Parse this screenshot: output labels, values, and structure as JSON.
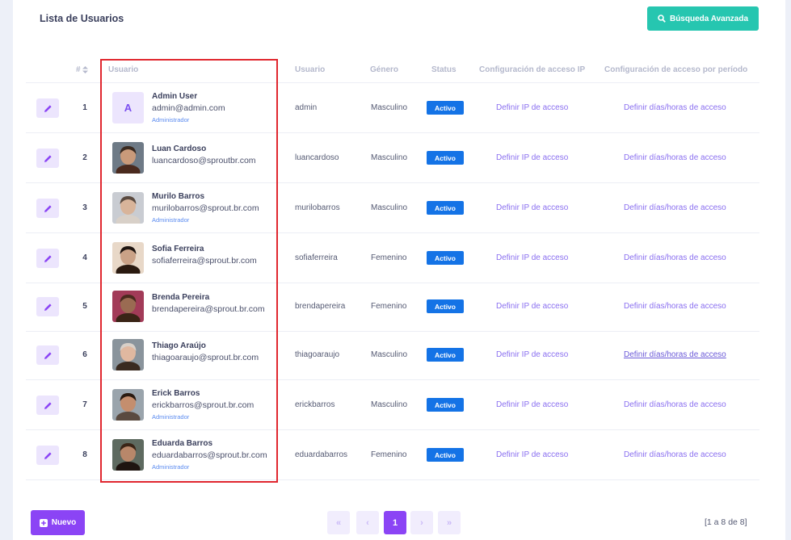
{
  "header": {
    "title": "Lista de Usuarios",
    "advanced_search_label": "Búsqueda Avanzada"
  },
  "columns": {
    "num": "#",
    "user": "Usuario",
    "username": "Usuario",
    "gender": "Género",
    "status": "Status",
    "ip_config": "Configuración de acceso IP",
    "period_config": "Configuración de acceso por período"
  },
  "rows": [
    {
      "num": "1",
      "avatar": "letter",
      "avatar_letter": "A",
      "name": "Admin User",
      "email": "admin@admin.com",
      "role": "Administrador",
      "username": "admin",
      "gender": "Masculino",
      "status": "Activo",
      "ip_link": "Definir IP de acceso",
      "period_link": "Definir días/horas de acceso"
    },
    {
      "num": "2",
      "avatar": "photo",
      "name": "Luan Cardoso",
      "email": "luancardoso@sproutbr.com",
      "role": "",
      "username": "luancardoso",
      "gender": "Masculino",
      "status": "Activo",
      "ip_link": "Definir IP de acceso",
      "period_link": "Definir días/horas de acceso"
    },
    {
      "num": "3",
      "avatar": "photo",
      "name": "Murilo Barros",
      "email": "murilobarros@sprout.br.com",
      "role": "Administrador",
      "username": "murilobarros",
      "gender": "Masculino",
      "status": "Activo",
      "ip_link": "Definir IP de acceso",
      "period_link": "Definir días/horas de acceso"
    },
    {
      "num": "4",
      "avatar": "photo",
      "name": "Sofia Ferreira",
      "email": "sofiaferreira@sprout.br.com",
      "role": "",
      "username": "sofiaferreira",
      "gender": "Femenino",
      "status": "Activo",
      "ip_link": "Definir IP de acceso",
      "period_link": "Definir días/horas de acceso"
    },
    {
      "num": "5",
      "avatar": "photo",
      "name": "Brenda Pereira",
      "email": "brendapereira@sprout.br.com",
      "role": "",
      "username": "brendapereira",
      "gender": "Femenino",
      "status": "Activo",
      "ip_link": "Definir IP de acceso",
      "period_link": "Definir días/horas de acceso"
    },
    {
      "num": "6",
      "avatar": "photo",
      "name": "Thiago Araújo",
      "email": "thiagoaraujo@sprout.br.com",
      "role": "",
      "username": "thiagoaraujo",
      "gender": "Masculino",
      "status": "Activo",
      "ip_link": "Definir IP de acceso",
      "period_link": "Definir días/horas de acceso"
    },
    {
      "num": "7",
      "avatar": "photo",
      "name": "Erick Barros",
      "email": "erickbarros@sprout.br.com",
      "role": "Administrador",
      "username": "erickbarros",
      "gender": "Masculino",
      "status": "Activo",
      "ip_link": "Definir IP de acceso",
      "period_link": "Definir días/horas de acceso"
    },
    {
      "num": "8",
      "avatar": "photo",
      "name": "Eduarda Barros",
      "email": "eduardabarros@sprout.br.com",
      "role": "Administrador",
      "username": "eduardabarros",
      "gender": "Femenino",
      "status": "Activo",
      "ip_link": "Definir IP de acceso",
      "period_link": "Definir días/horas de acceso"
    }
  ],
  "footer": {
    "new_label": "Nuevo",
    "pagination": {
      "first": "«",
      "prev": "‹",
      "current": "1",
      "next": "›",
      "last": "»"
    },
    "range_info": "[1 a 8 de 8]"
  },
  "colors": {
    "primary": "#8b44f5",
    "teal": "#26c6b0",
    "status_active": "#1473e6",
    "link": "#8a6ff0",
    "highlight": "#e0272f"
  }
}
